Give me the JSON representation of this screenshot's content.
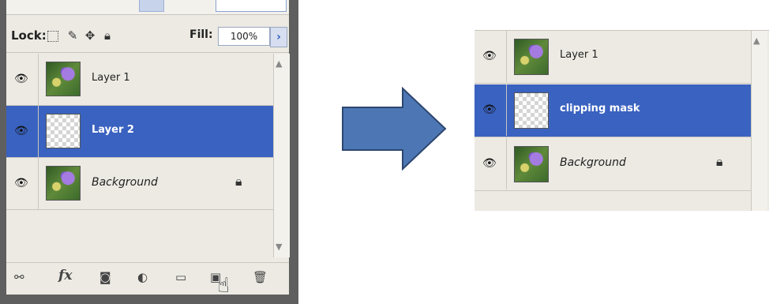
{
  "left_panel": {
    "lock_label": "Lock:",
    "fill_label": "Fill:",
    "fill_value": "100%",
    "layers": [
      {
        "name": "Layer 1",
        "selected": false,
        "thumb": "flower"
      },
      {
        "name": "Layer 2",
        "selected": true,
        "thumb": "checker"
      },
      {
        "name": "Background",
        "selected": false,
        "thumb": "flower",
        "locked": true
      }
    ],
    "bottom_icons": [
      "link-icon",
      "fx-icon",
      "mask-icon",
      "adjustment-icon",
      "group-icon",
      "new-layer-icon",
      "trash-icon"
    ],
    "fx_label": "fx"
  },
  "right_panel": {
    "layers": [
      {
        "name": "Layer 1",
        "selected": false,
        "thumb": "flower"
      },
      {
        "name": "clipping mask",
        "selected": true,
        "thumb": "checker"
      },
      {
        "name": "Background",
        "selected": false,
        "thumb": "flower",
        "locked": true
      }
    ]
  },
  "colors": {
    "selection": "#3a62c0",
    "arrow_fill": "#4d77b4",
    "arrow_stroke": "#2d4770",
    "panel_bg": "#eceae3"
  }
}
